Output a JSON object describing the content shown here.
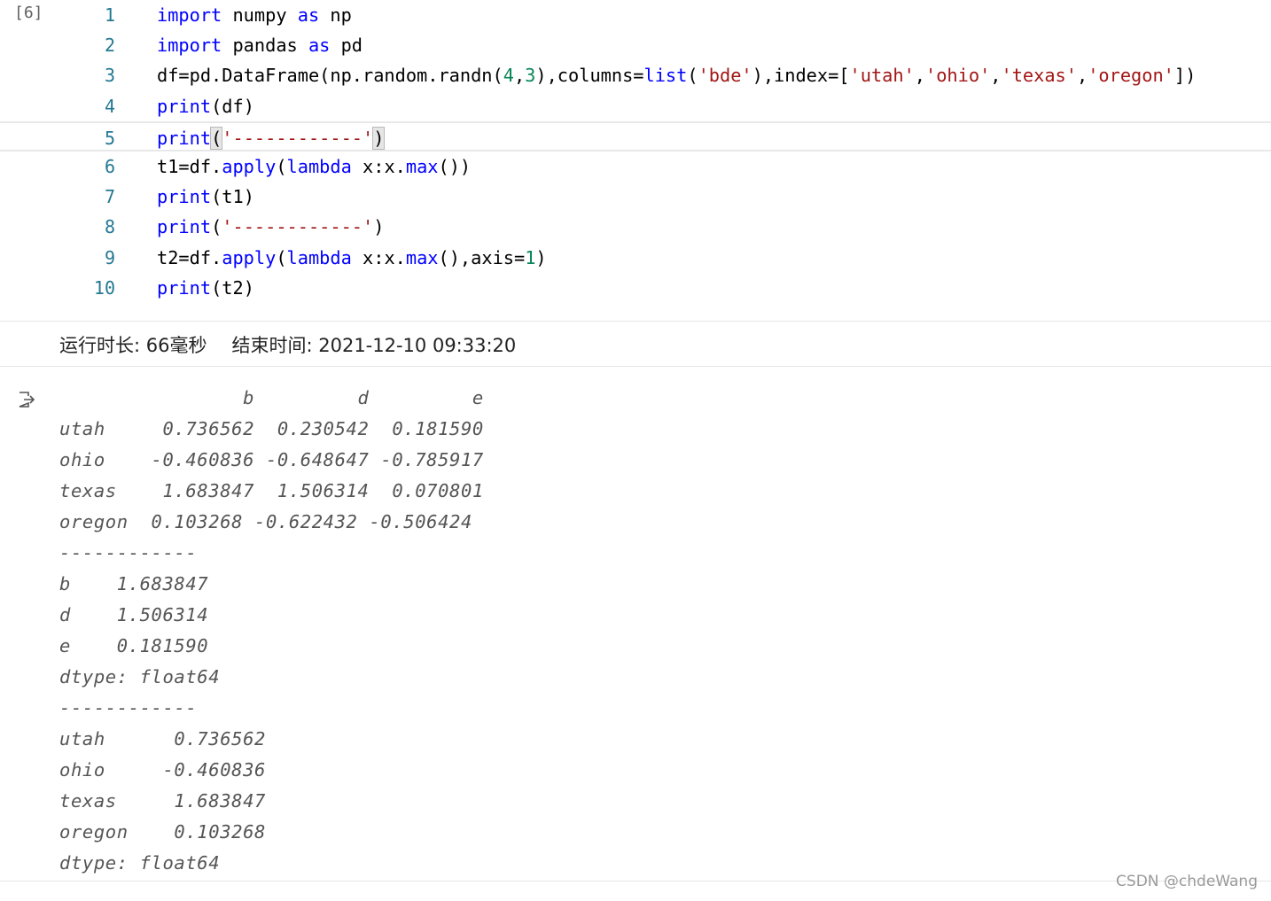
{
  "cell": {
    "execution_count": "[6]",
    "code_lines": [
      {
        "num": "1",
        "tokens": [
          {
            "t": "import",
            "c": "kw"
          },
          {
            "t": " numpy "
          },
          {
            "t": "as",
            "c": "kw"
          },
          {
            "t": " np"
          }
        ]
      },
      {
        "num": "2",
        "tokens": [
          {
            "t": "import",
            "c": "kw"
          },
          {
            "t": " pandas "
          },
          {
            "t": "as",
            "c": "kw"
          },
          {
            "t": " pd"
          }
        ]
      },
      {
        "num": "3",
        "tokens": [
          {
            "t": "df=pd.DataFrame(np.random.randn("
          },
          {
            "t": "4",
            "c": "num"
          },
          {
            "t": ","
          },
          {
            "t": "3",
            "c": "num"
          },
          {
            "t": "),columns="
          },
          {
            "t": "list",
            "c": "fn"
          },
          {
            "t": "("
          },
          {
            "t": "'bde'",
            "c": "str"
          },
          {
            "t": "),index=["
          },
          {
            "t": "'utah'",
            "c": "str"
          },
          {
            "t": ","
          },
          {
            "t": "'ohio'",
            "c": "str"
          },
          {
            "t": ","
          },
          {
            "t": "'texas'",
            "c": "str"
          },
          {
            "t": ","
          },
          {
            "t": "'oregon'",
            "c": "str"
          },
          {
            "t": "])"
          }
        ]
      },
      {
        "num": "4",
        "tokens": [
          {
            "t": "print",
            "c": "fn"
          },
          {
            "t": "(df)"
          }
        ]
      },
      {
        "num": "5",
        "tokens": [
          {
            "t": "print",
            "c": "fn"
          },
          {
            "t": "(",
            "c": "br"
          },
          {
            "t": "'------------'",
            "c": "str"
          },
          {
            "t": ")",
            "c": "br"
          }
        ]
      },
      {
        "num": "6",
        "tokens": [
          {
            "t": "t1=df."
          },
          {
            "t": "apply",
            "c": "fn"
          },
          {
            "t": "("
          },
          {
            "t": "lambda",
            "c": "kw"
          },
          {
            "t": " x:x."
          },
          {
            "t": "max",
            "c": "fn"
          },
          {
            "t": "())"
          }
        ]
      },
      {
        "num": "7",
        "tokens": [
          {
            "t": "print",
            "c": "fn"
          },
          {
            "t": "(t1)"
          }
        ]
      },
      {
        "num": "8",
        "tokens": [
          {
            "t": "print",
            "c": "fn"
          },
          {
            "t": "("
          },
          {
            "t": "'------------'",
            "c": "str"
          },
          {
            "t": ")"
          }
        ]
      },
      {
        "num": "9",
        "tokens": [
          {
            "t": "t2=df."
          },
          {
            "t": "apply",
            "c": "fn"
          },
          {
            "t": "("
          },
          {
            "t": "lambda",
            "c": "kw"
          },
          {
            "t": " x:x."
          },
          {
            "t": "max",
            "c": "fn"
          },
          {
            "t": "(),axis="
          },
          {
            "t": "1",
            "c": "num"
          },
          {
            "t": ")"
          }
        ]
      },
      {
        "num": "10",
        "tokens": [
          {
            "t": "print",
            "c": "fn"
          },
          {
            "t": "(t2)"
          }
        ]
      }
    ],
    "active_line": 5
  },
  "status": {
    "duration_label": "运行时长: 66毫秒",
    "end_time_label": "结束时间: 2021-12-10 09:33:20"
  },
  "output": {
    "icon": "output-redirect-icon",
    "lines": [
      "                b         d         e",
      "utah     0.736562  0.230542  0.181590",
      "ohio    -0.460836 -0.648647 -0.785917",
      "texas    1.683847  1.506314  0.070801",
      "oregon  0.103268 -0.622432 -0.506424",
      "------------",
      "b    1.683847",
      "d    1.506314",
      "e    0.181590",
      "dtype: float64",
      "------------",
      "utah      0.736562",
      "ohio     -0.460836",
      "texas     1.683847",
      "oregon    0.103268",
      "dtype: float64"
    ]
  },
  "watermark": "CSDN @chdeWang",
  "colors": {
    "keyword": "#0000ff",
    "string": "#a31515",
    "number": "#098658",
    "line_number": "#237893",
    "output_text": "#555555"
  }
}
